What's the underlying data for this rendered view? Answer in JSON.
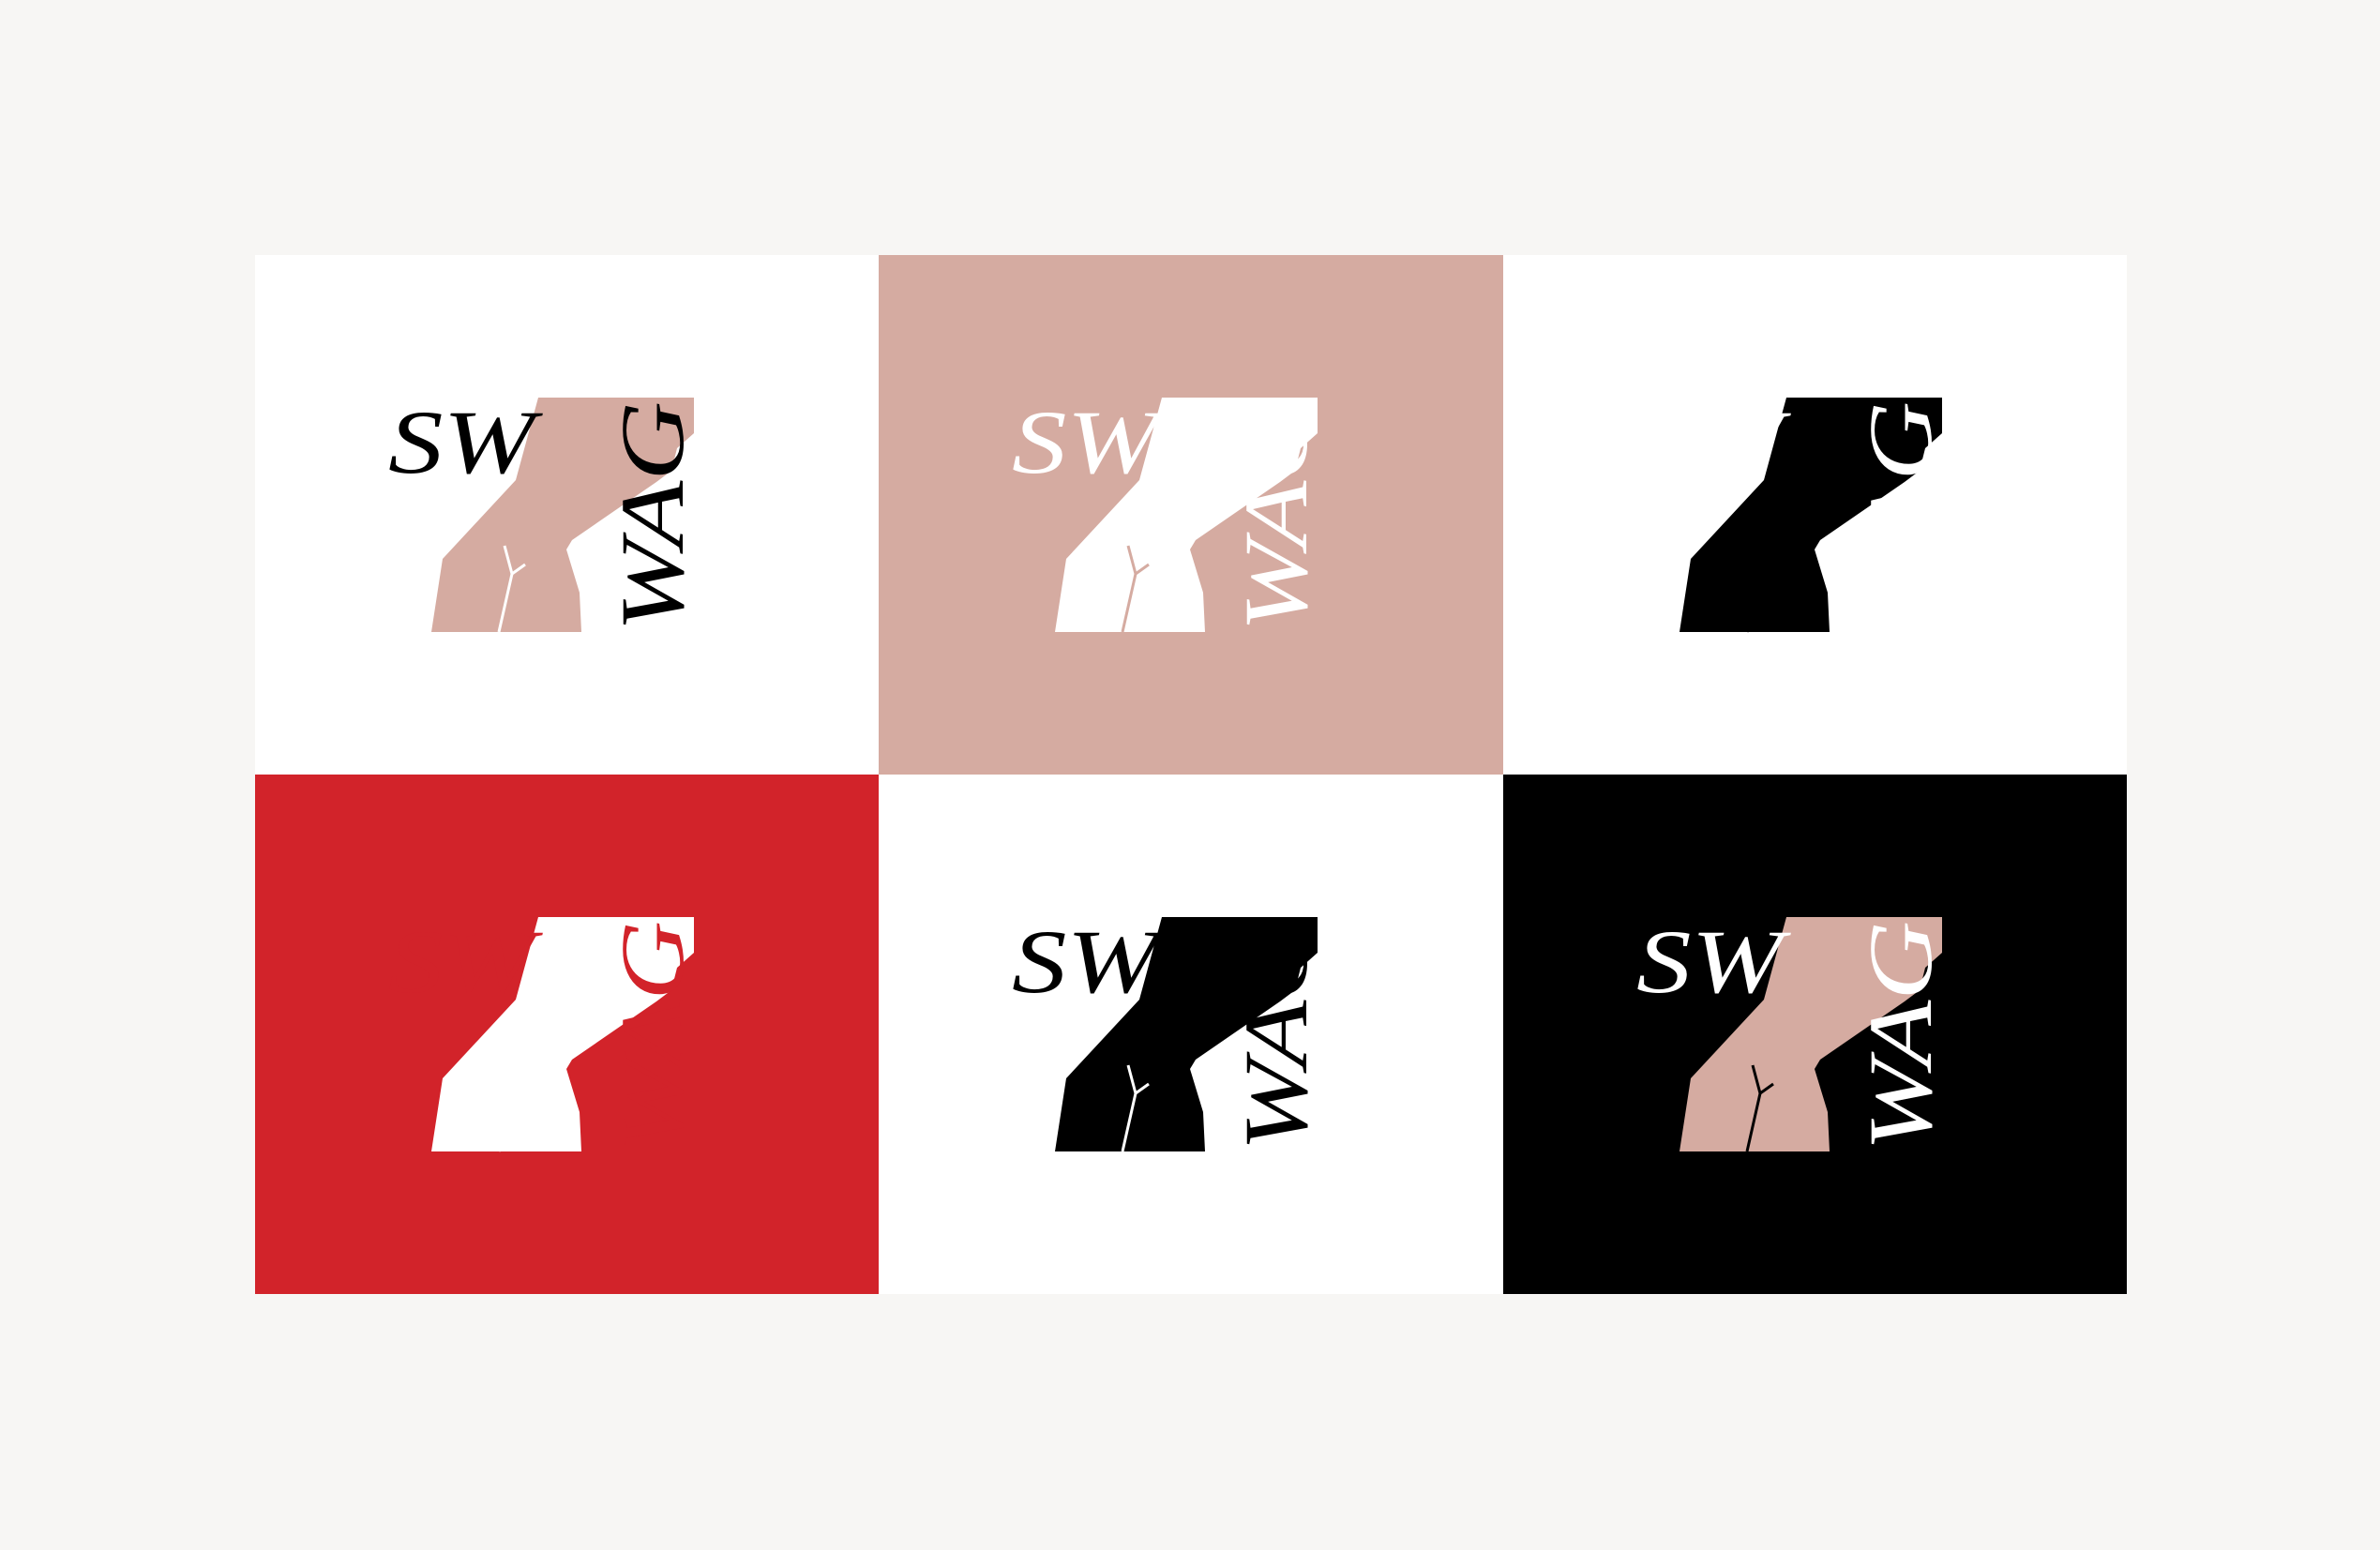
{
  "brand": {
    "text_top": "SW",
    "text_side": "WAG"
  },
  "tiles": [
    {
      "bg": "#ffffff",
      "shape": "#d5aba1",
      "text": "#000000",
      "line": "#ffffff"
    },
    {
      "bg": "#d5aba1",
      "shape": "#ffffff",
      "text": "#ffffff",
      "line": "#d5aba1"
    },
    {
      "bg": "#ffffff",
      "shape": "#000000",
      "text": "#ffffff",
      "line": "#000000"
    },
    {
      "bg": "#d2232a",
      "shape": "#ffffff",
      "text": "#d2232a",
      "line": "#ffffff"
    },
    {
      "bg": "#ffffff",
      "shape": "#000000",
      "text": "#000000",
      "line": "#ffffff"
    },
    {
      "bg": "#000000",
      "shape": "#d5aba1",
      "text": "#ffffff",
      "line": "#000000"
    }
  ]
}
